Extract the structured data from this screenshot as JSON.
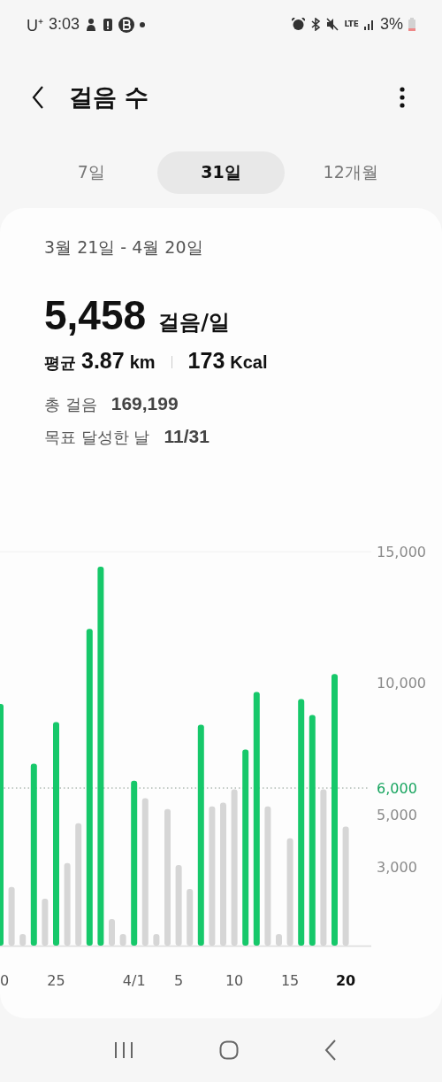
{
  "status_bar": {
    "carrier": "U⁺",
    "time": "3:03",
    "network": "LTE",
    "battery": "3%"
  },
  "header": {
    "title": "걸음 수"
  },
  "tabs": [
    {
      "label": "7일",
      "selected": false
    },
    {
      "label": "31일",
      "selected": true
    },
    {
      "label": "12개월",
      "selected": false
    }
  ],
  "summary": {
    "date_range": "3월 21일 - 4월 20일",
    "daily_steps": "5,458",
    "daily_unit": "걸음/일",
    "average_label": "평균",
    "distance": "3.87",
    "distance_unit": "km",
    "calories": "173",
    "calories_unit": "Kcal",
    "stats": [
      {
        "label": "총 걸음",
        "value": "169,199"
      },
      {
        "label": "목표 달성한 날",
        "value": "11/31"
      }
    ]
  },
  "chart": {
    "goal_marker": {
      "color": "#19a560"
    }
  },
  "chart_data": {
    "type": "bar",
    "stacked": true,
    "categories": [
      "0",
      null,
      null,
      null,
      null,
      "25",
      null,
      null,
      null,
      null,
      null,
      null,
      "4/1",
      null,
      null,
      null,
      "5",
      null,
      null,
      null,
      null,
      "10",
      null,
      null,
      null,
      null,
      "15",
      null,
      null,
      null,
      null,
      "20"
    ],
    "series": [
      {
        "color": "#16c86a",
        "values": [
          9200,
          null,
          null,
          6930,
          null,
          8510,
          null,
          null,
          12060,
          14430,
          null,
          null,
          6280,
          null,
          null,
          null,
          null,
          null,
          8410,
          null,
          null,
          null,
          7470,
          9660,
          null,
          null,
          null,
          9390,
          8780,
          null,
          10340,
          null
        ]
      },
      {
        "color": "#d6d6d6",
        "values": [
          null,
          2230,
          440,
          null,
          1790,
          null,
          3140,
          4660,
          null,
          null,
          1010,
          440,
          null,
          5610,
          440,
          5200,
          3070,
          2160,
          null,
          5300,
          5440,
          5950,
          null,
          null,
          5300,
          440,
          4090,
          null,
          null,
          5950,
          null,
          4530
        ]
      }
    ],
    "ylim": [
      0,
      15000
    ],
    "yticks": [
      {
        "value": 3000,
        "label": "3,000"
      },
      {
        "value": 5000,
        "label": "5,000"
      },
      {
        "value": 6000,
        "label": "6,000"
      },
      {
        "value": 10000,
        "label": "10,000"
      },
      {
        "value": 15000,
        "label": "15,000"
      }
    ]
  }
}
